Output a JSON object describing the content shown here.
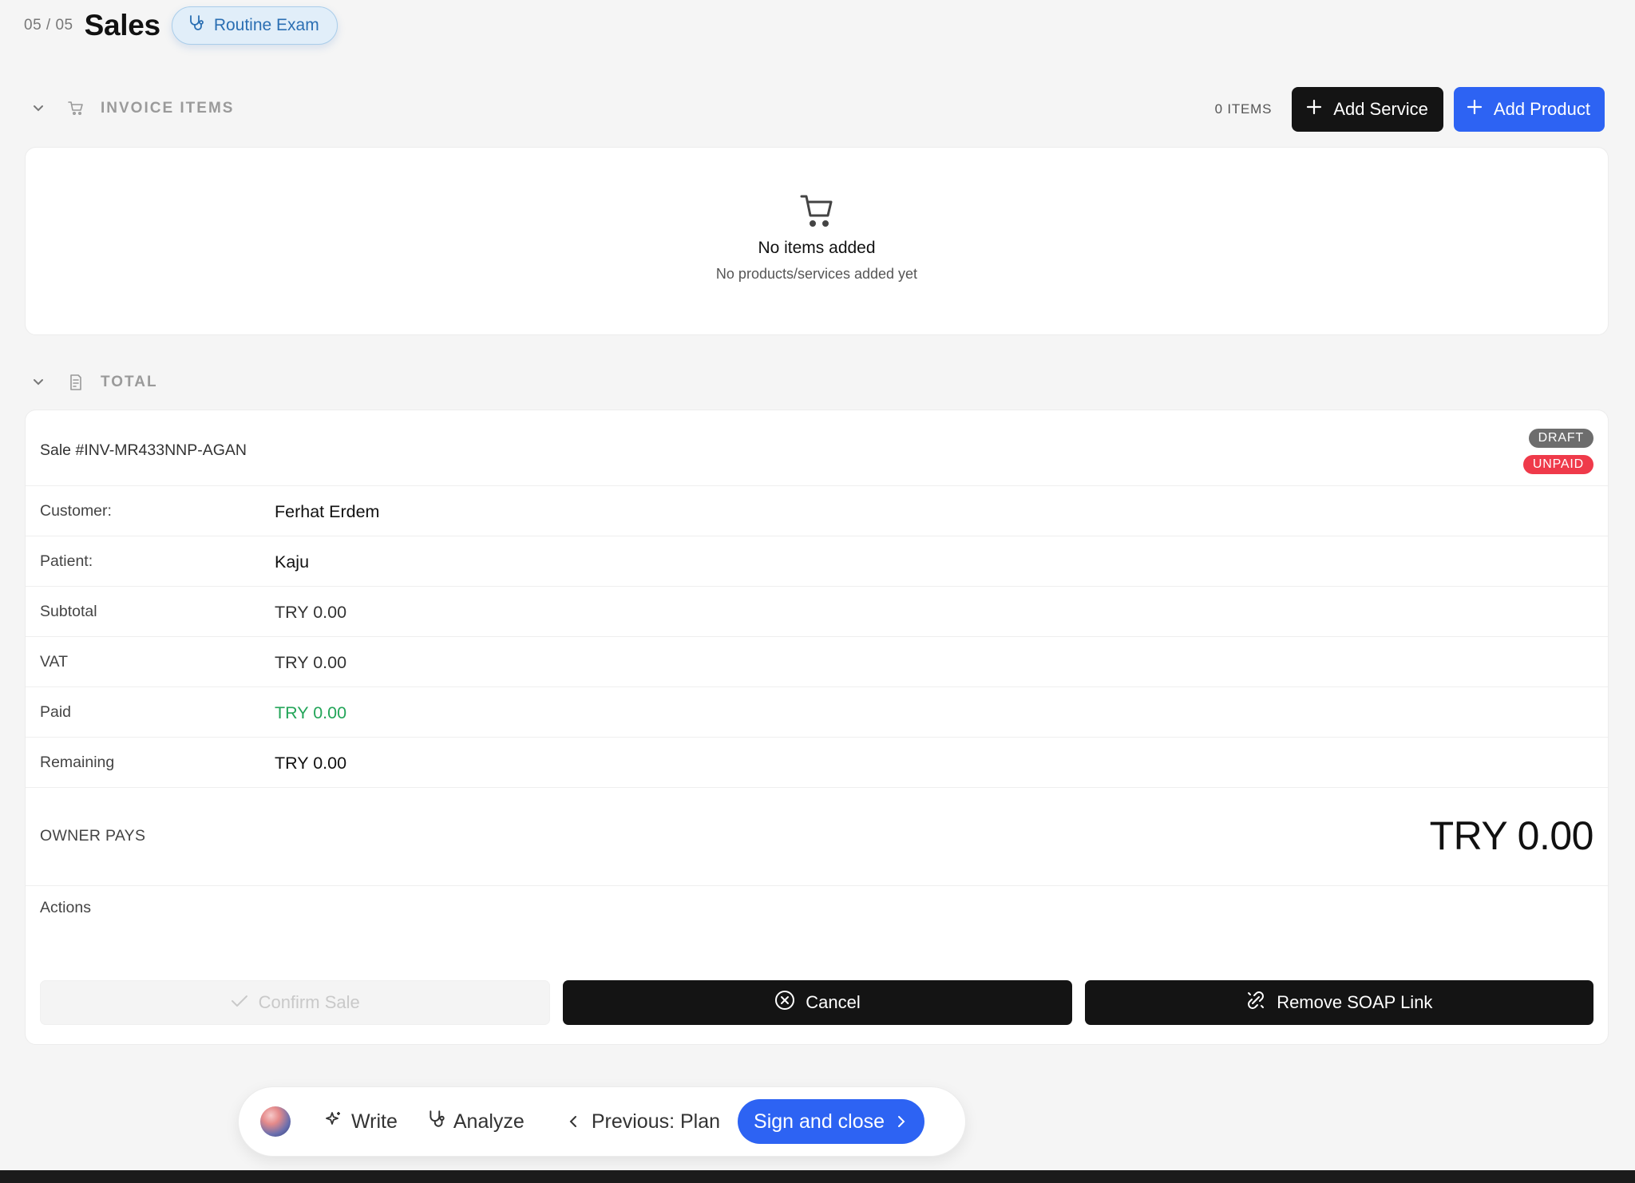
{
  "header": {
    "step": "05 / 05",
    "title": "Sales",
    "tag": "Routine Exam"
  },
  "invoice_items": {
    "section_label": "INVOICE ITEMS",
    "count_label": "0 ITEMS",
    "add_service_label": "Add Service",
    "add_product_label": "Add Product",
    "empty_title": "No items added",
    "empty_subtitle": "No products/services added yet"
  },
  "total": {
    "section_label": "TOTAL",
    "sale_id": "Sale #INV-MR433NNP-AGAN",
    "badges": {
      "draft": "DRAFT",
      "unpaid": "UNPAID"
    },
    "rows": [
      {
        "label": "Customer:",
        "value": "Ferhat Erdem"
      },
      {
        "label": "Patient:",
        "value": "Kaju"
      },
      {
        "label": "Subtotal",
        "value": "TRY 0.00"
      },
      {
        "label": "VAT",
        "value": "TRY 0.00"
      },
      {
        "label": "Paid",
        "value": "TRY 0.00"
      },
      {
        "label": "Remaining",
        "value": "TRY 0.00"
      }
    ],
    "owner_pays_label": "OWNER PAYS",
    "owner_pays_value": "TRY 0.00",
    "actions_label": "Actions",
    "actions": {
      "confirm": "Confirm Sale",
      "cancel": "Cancel",
      "remove_soap": "Remove SOAP Link"
    }
  },
  "dock": {
    "write": "Write",
    "analyze": "Analyze",
    "previous": "Previous: Plan",
    "sign": "Sign and close"
  },
  "colors": {
    "accent_blue": "#2d63f3",
    "dark_button": "#141414",
    "paid_green": "#23a559",
    "unpaid_red": "#ef3a4a",
    "draft_gray": "#6d6d6d",
    "tag_blue": "#2b6fb3"
  },
  "icons": [
    "stethoscope-icon",
    "chevron-down-icon",
    "cart-icon",
    "receipt-icon",
    "plus-icon",
    "check-icon",
    "x-circle-icon",
    "unlink-icon",
    "sparkle-icon",
    "chevron-left-icon",
    "chevron-right-icon"
  ]
}
